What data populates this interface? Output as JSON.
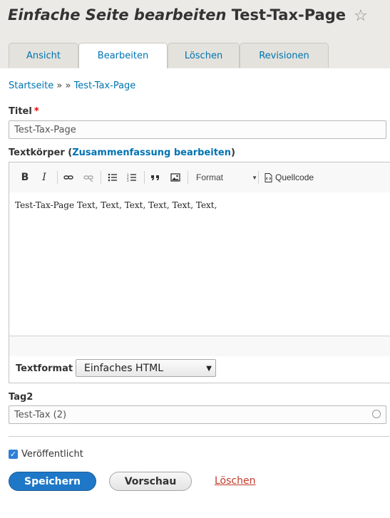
{
  "header": {
    "title_prefix": "Einfache Seite bearbeiten",
    "title_name": "Test-Tax-Page",
    "star": "☆"
  },
  "tabs": [
    {
      "label": "Ansicht"
    },
    {
      "label": "Bearbeiten"
    },
    {
      "label": "Löschen"
    },
    {
      "label": "Revisionen"
    }
  ],
  "breadcrumb": {
    "home": "Startseite",
    "separator": "» »",
    "current": "Test-Tax-Page"
  },
  "title_field": {
    "label": "Titel",
    "required_marker": "*",
    "value": "Test-Tax-Page"
  },
  "body_field": {
    "label": "Textkörper",
    "open_paren": "(",
    "summary_link": "Zusammenfassung bearbeiten",
    "close_paren": ")",
    "content": "Test-Tax-Page Text, Text, Text, Text, Text, Text,"
  },
  "toolbar": {
    "bold": "B",
    "italic": "I",
    "format_label": "Format",
    "source_label": "Quellcode"
  },
  "text_format": {
    "label": "Textformat",
    "selected": "Einfaches HTML"
  },
  "tag_field": {
    "label": "Tag2",
    "value": "Test-Tax (2)"
  },
  "published": {
    "label": "Veröffentlicht",
    "checked": true,
    "check_mark": "✓"
  },
  "actions": {
    "save": "Speichern",
    "preview": "Vorschau",
    "delete": "Löschen"
  },
  "colors": {
    "link": "#0073b2",
    "primary_button": "#1f78c7",
    "delete_link": "#c0392b",
    "header_bg": "#ebeae6"
  }
}
